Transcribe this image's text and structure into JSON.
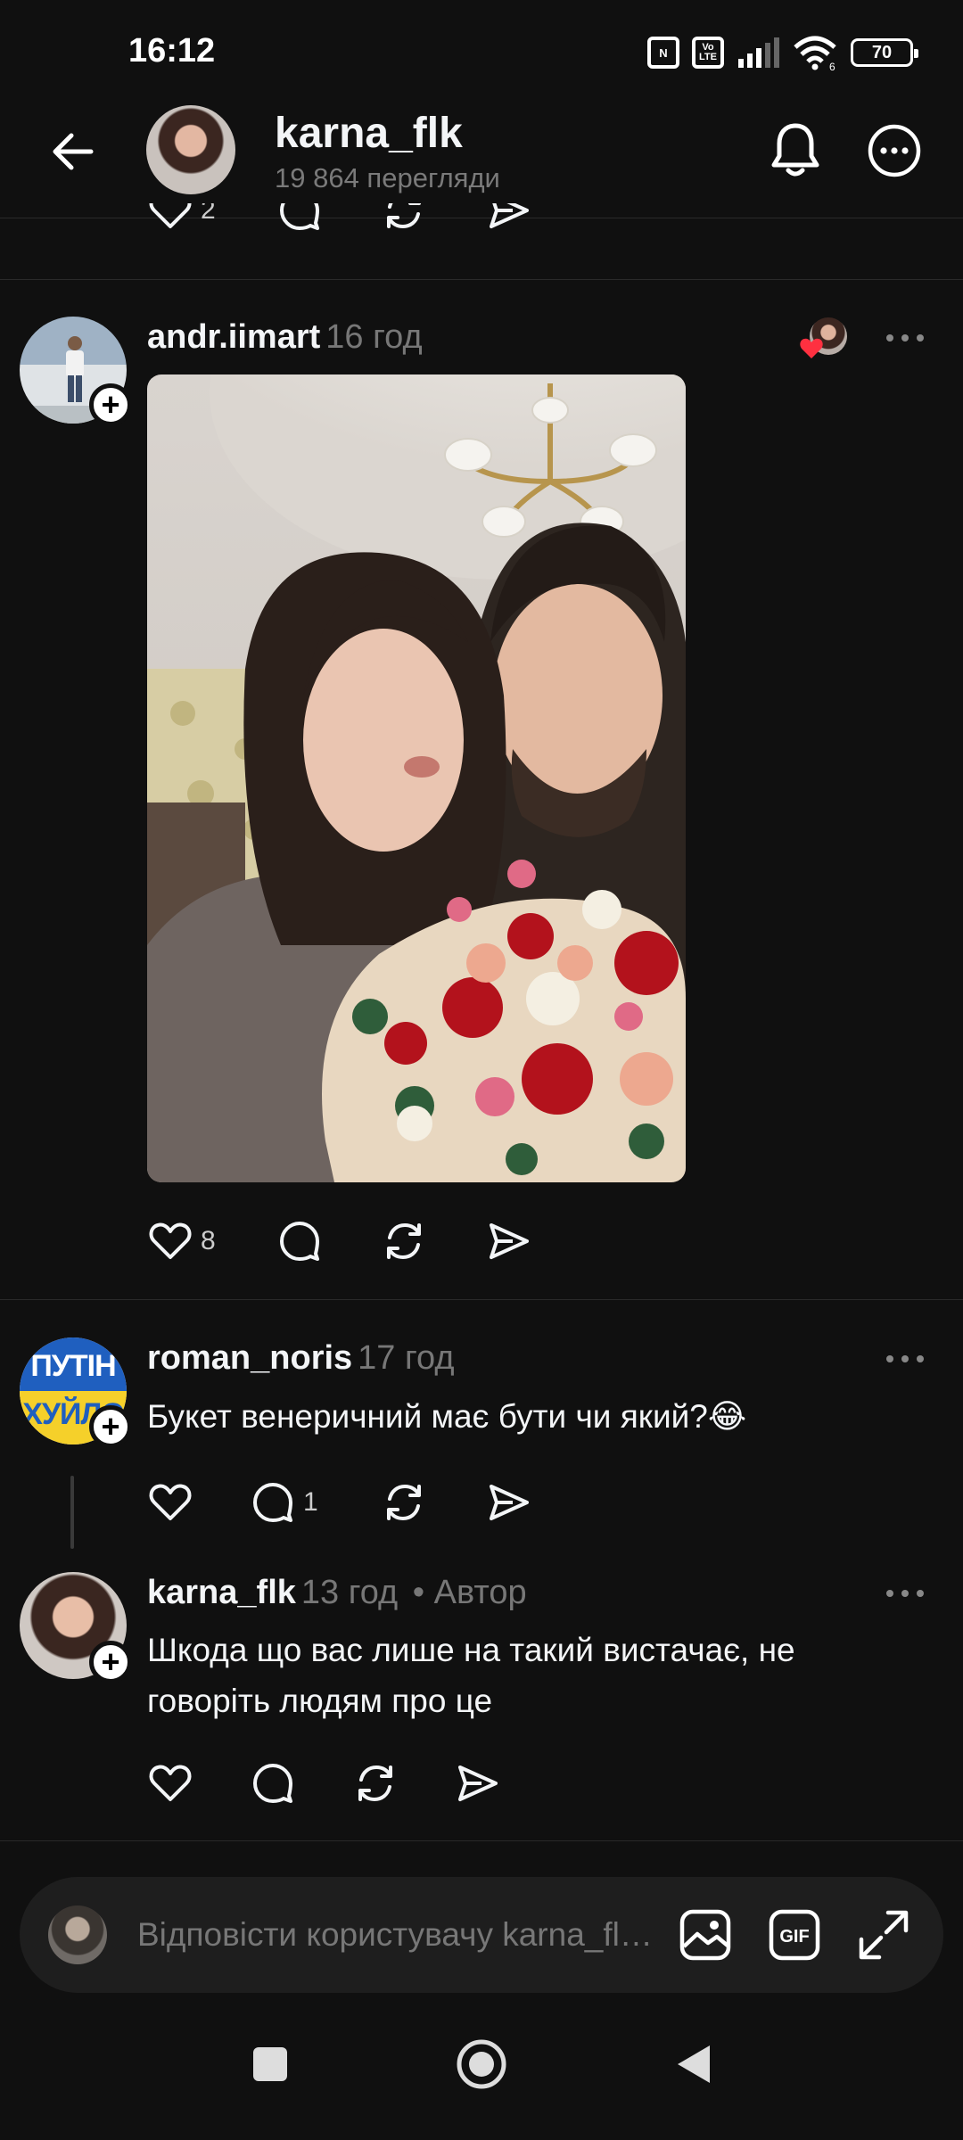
{
  "status": {
    "time": "16:12",
    "battery": "70",
    "volte": "Vo LTE",
    "nfc": "N",
    "wifi_badge": "6"
  },
  "header": {
    "username": "karna_flk",
    "views": "19 864 перегляди"
  },
  "top_post": {
    "likes": "2"
  },
  "post": {
    "username": "andr.iimart",
    "time": "16 год",
    "likes": "8"
  },
  "comments": [
    {
      "username": "roman_noris",
      "time": "17 год",
      "text": "Букет венеричний має бути чи який?😂",
      "replies": "1",
      "avatar_text_top": "ПУТІН",
      "avatar_text_bottom": "ХУЙЛО"
    },
    {
      "username": "karna_flk",
      "time": "13 год",
      "author_tag": "• Автор",
      "text": "Шкода що вас лише на такий вистачає, не говоріть людям про це"
    }
  ],
  "reply_bar": {
    "placeholder": "Відповісти користувачу karna_flk…"
  },
  "colors": {
    "background": "#101010",
    "text": "#f3f5f7",
    "muted": "#777777",
    "like_red": "#ff3040"
  },
  "icons": [
    "back-arrow-icon",
    "bell-icon",
    "more-icon",
    "heart-icon",
    "comment-icon",
    "repost-icon",
    "share-icon",
    "image-icon",
    "gif-icon",
    "expand-icon",
    "nav-square-icon",
    "nav-home-icon",
    "nav-back-icon"
  ]
}
